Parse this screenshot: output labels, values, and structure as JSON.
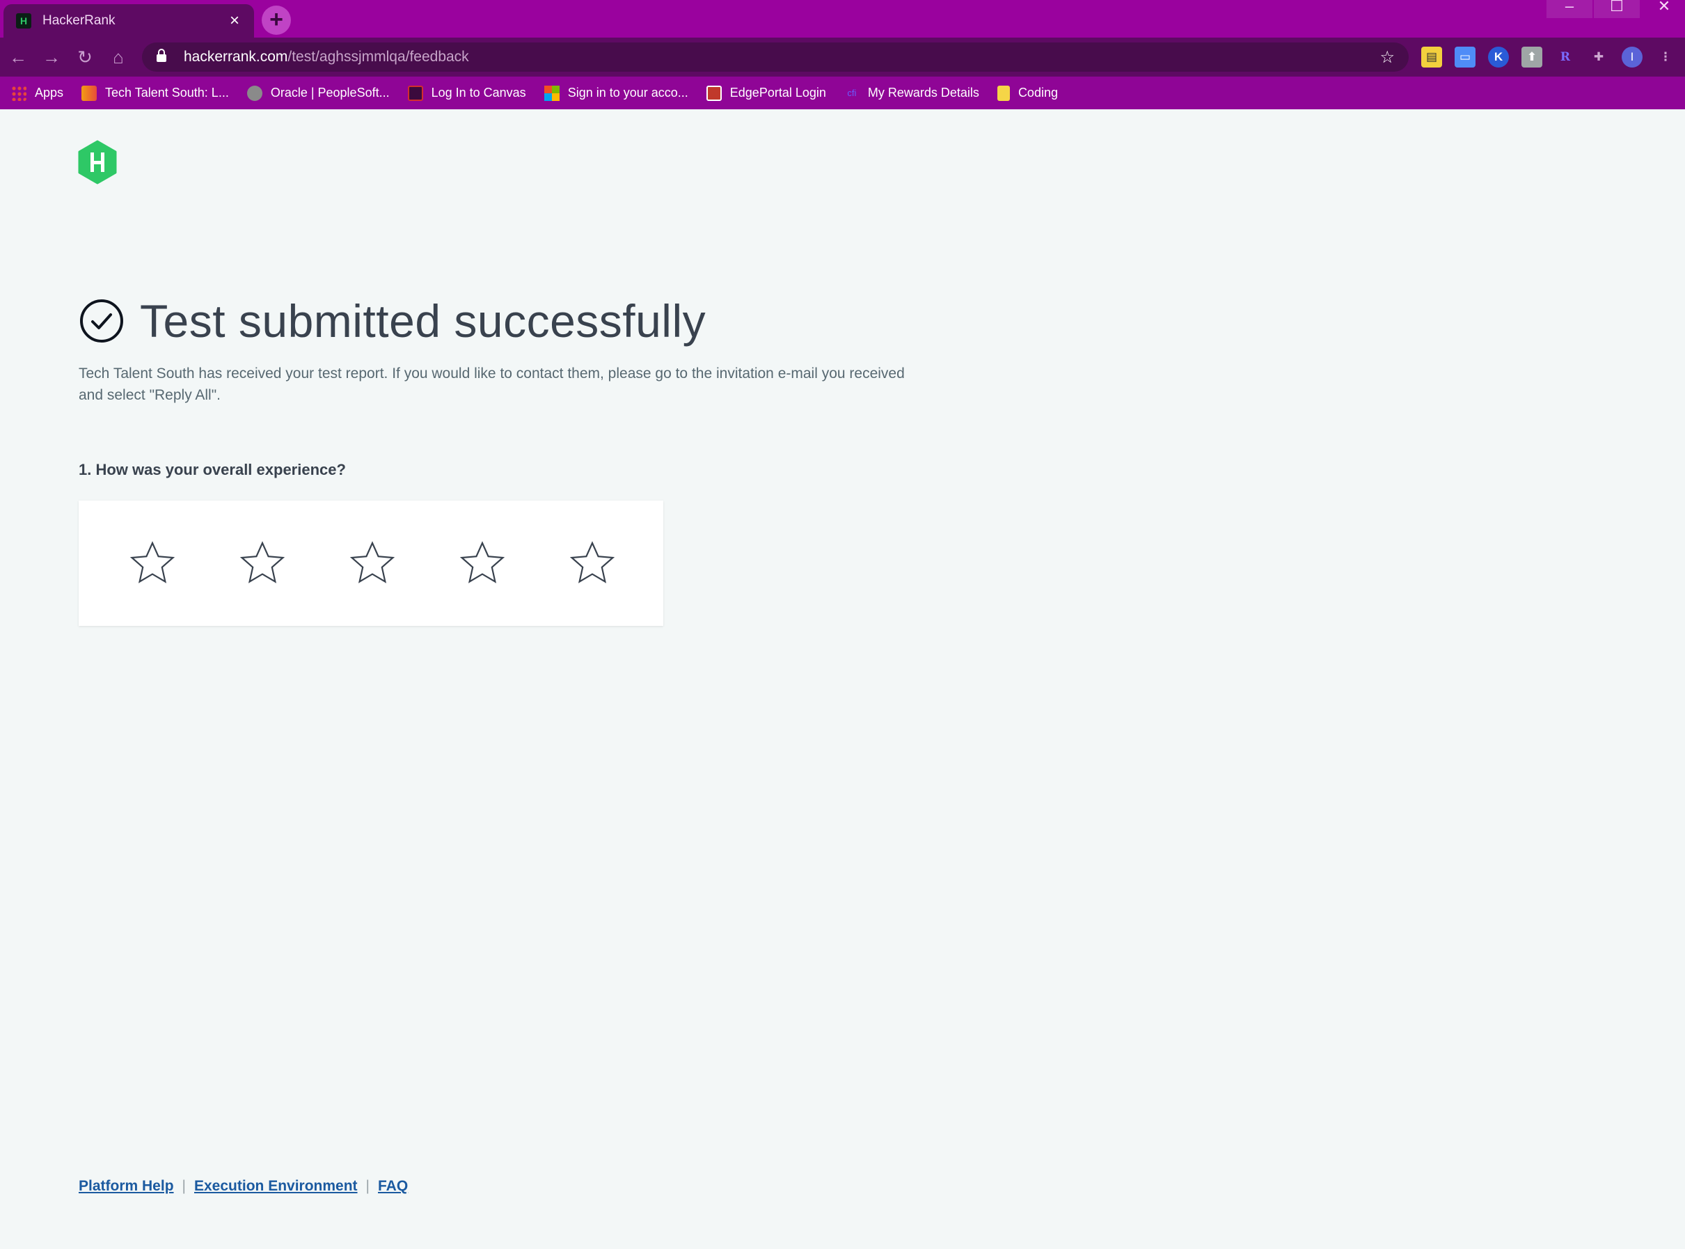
{
  "browser": {
    "tab": {
      "title": "HackerRank",
      "favicon_text": "H",
      "close": "×"
    },
    "new_tab": "+",
    "window_controls": {
      "minimize": "–",
      "maximize": "☐",
      "close": "✕"
    },
    "nav": {
      "back": "←",
      "forward": "→",
      "reload": "↻",
      "home": "⌂"
    },
    "address": {
      "host": "hackerrank.com",
      "path": "/test/aghssjmmlqa/feedback"
    },
    "extensions": [
      "keyboard-icon",
      "doc-icon",
      "K",
      "rocket-icon",
      "R",
      "puzzle-icon"
    ],
    "profile_initial": "I",
    "menu": "⋮",
    "bookmarks": [
      {
        "label": "Apps",
        "icon": "apps-grid-icon",
        "color": "#e8453c"
      },
      {
        "label": "Tech Talent South: L...",
        "icon": "tts-icon",
        "color": "#f39c12"
      },
      {
        "label": "Oracle | PeopleSoft...",
        "icon": "globe-icon",
        "color": "#8a8a8a"
      },
      {
        "label": "Log In to Canvas",
        "icon": "canvas-icon",
        "color": "#d22e2e"
      },
      {
        "label": "Sign in to your acco...",
        "icon": "microsoft-icon",
        "color": "#f25022"
      },
      {
        "label": "EdgePortal Login",
        "icon": "edge-portal-icon",
        "color": "#c0392b"
      },
      {
        "label": "My Rewards Details",
        "icon": "rewards-icon",
        "color": "#4a3aff"
      },
      {
        "label": "Coding",
        "icon": "folder-icon",
        "color": "#f5d547"
      }
    ]
  },
  "page": {
    "title": "Test submitted successfully",
    "description": "Tech Talent South has received your test report. If you would like to contact them, please go to the invitation e-mail you received and select \"Reply All\".",
    "question": "1. How was your overall experience?",
    "rating": {
      "max": 5,
      "selected": 0
    },
    "footer_links": [
      "Platform Help",
      "Execution Environment",
      "FAQ"
    ],
    "colors": {
      "brand_green": "#2ec866",
      "heading": "#39424e",
      "link": "#1b5aa0",
      "chrome_purple": "#8f0596"
    }
  }
}
